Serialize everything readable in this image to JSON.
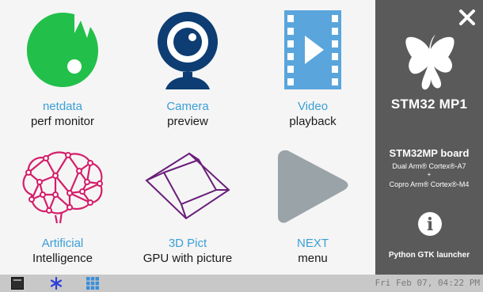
{
  "tiles": [
    {
      "line1": "netdata",
      "line2": "perf monitor",
      "icon": "netdata-icon"
    },
    {
      "line1": "Camera",
      "line2": "preview",
      "icon": "webcam-icon"
    },
    {
      "line1": "Video",
      "line2": "playback",
      "icon": "film-play-icon"
    },
    {
      "line1": "Artificial",
      "line2": "Intelligence",
      "icon": "brain-network-icon"
    },
    {
      "line1": "3D Pict",
      "line2": "GPU with picture",
      "icon": "cube-wireframe-icon"
    },
    {
      "line1": "NEXT",
      "line2": "menu",
      "icon": "next-arrow-icon"
    }
  ],
  "sidebar": {
    "brand_bold": "STM32",
    "brand_thin": "32",
    "brand_tail": " MP1",
    "board_title": "STM32MP board",
    "board_line1": "Dual Arm® Cortex®-A7",
    "board_plus": "+",
    "board_line2": "Copro Arm® Cortex®-M4",
    "info_glyph": "i",
    "launcher_label": "Python GTK launcher"
  },
  "taskbar": {
    "clock": "Fri Feb 07, 04:22 PM"
  },
  "colors": {
    "accent_blue": "#3a9fd6",
    "netdata_green": "#22c04a",
    "camera_navy": "#0d3d72",
    "video_blue": "#5aa5dc",
    "brain_pink": "#d41e6a",
    "cube_purple": "#6a1e7a",
    "next_gray": "#9aa3a8",
    "sidebar_bg": "#5a5a5a"
  }
}
